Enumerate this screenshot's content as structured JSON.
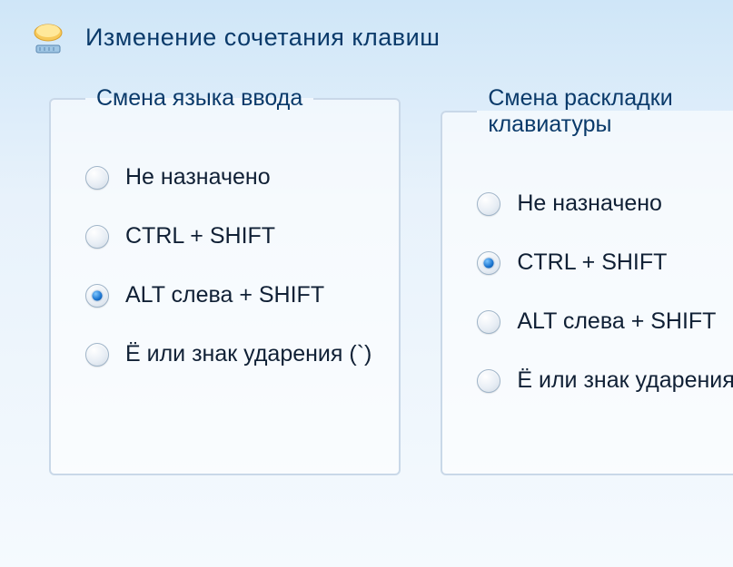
{
  "dialog": {
    "title": "Изменение сочетания клавиш",
    "icon": "keyboard-layout-icon"
  },
  "groups": [
    {
      "id": "input-language",
      "legend": "Смена языка ввода",
      "selected_index": 2,
      "options": [
        {
          "label": "Не назначено"
        },
        {
          "label": "CTRL + SHIFT"
        },
        {
          "label": "ALT слева + SHIFT"
        },
        {
          "label": "Ё или знак ударения (`)"
        }
      ]
    },
    {
      "id": "keyboard-layout",
      "legend": "Смена раскладки клавиатуры",
      "selected_index": 1,
      "options": [
        {
          "label": "Не назначено"
        },
        {
          "label": "CTRL + SHIFT"
        },
        {
          "label": "ALT слева + SHIFT"
        },
        {
          "label": "Ё или знак ударения (`)"
        }
      ]
    }
  ]
}
